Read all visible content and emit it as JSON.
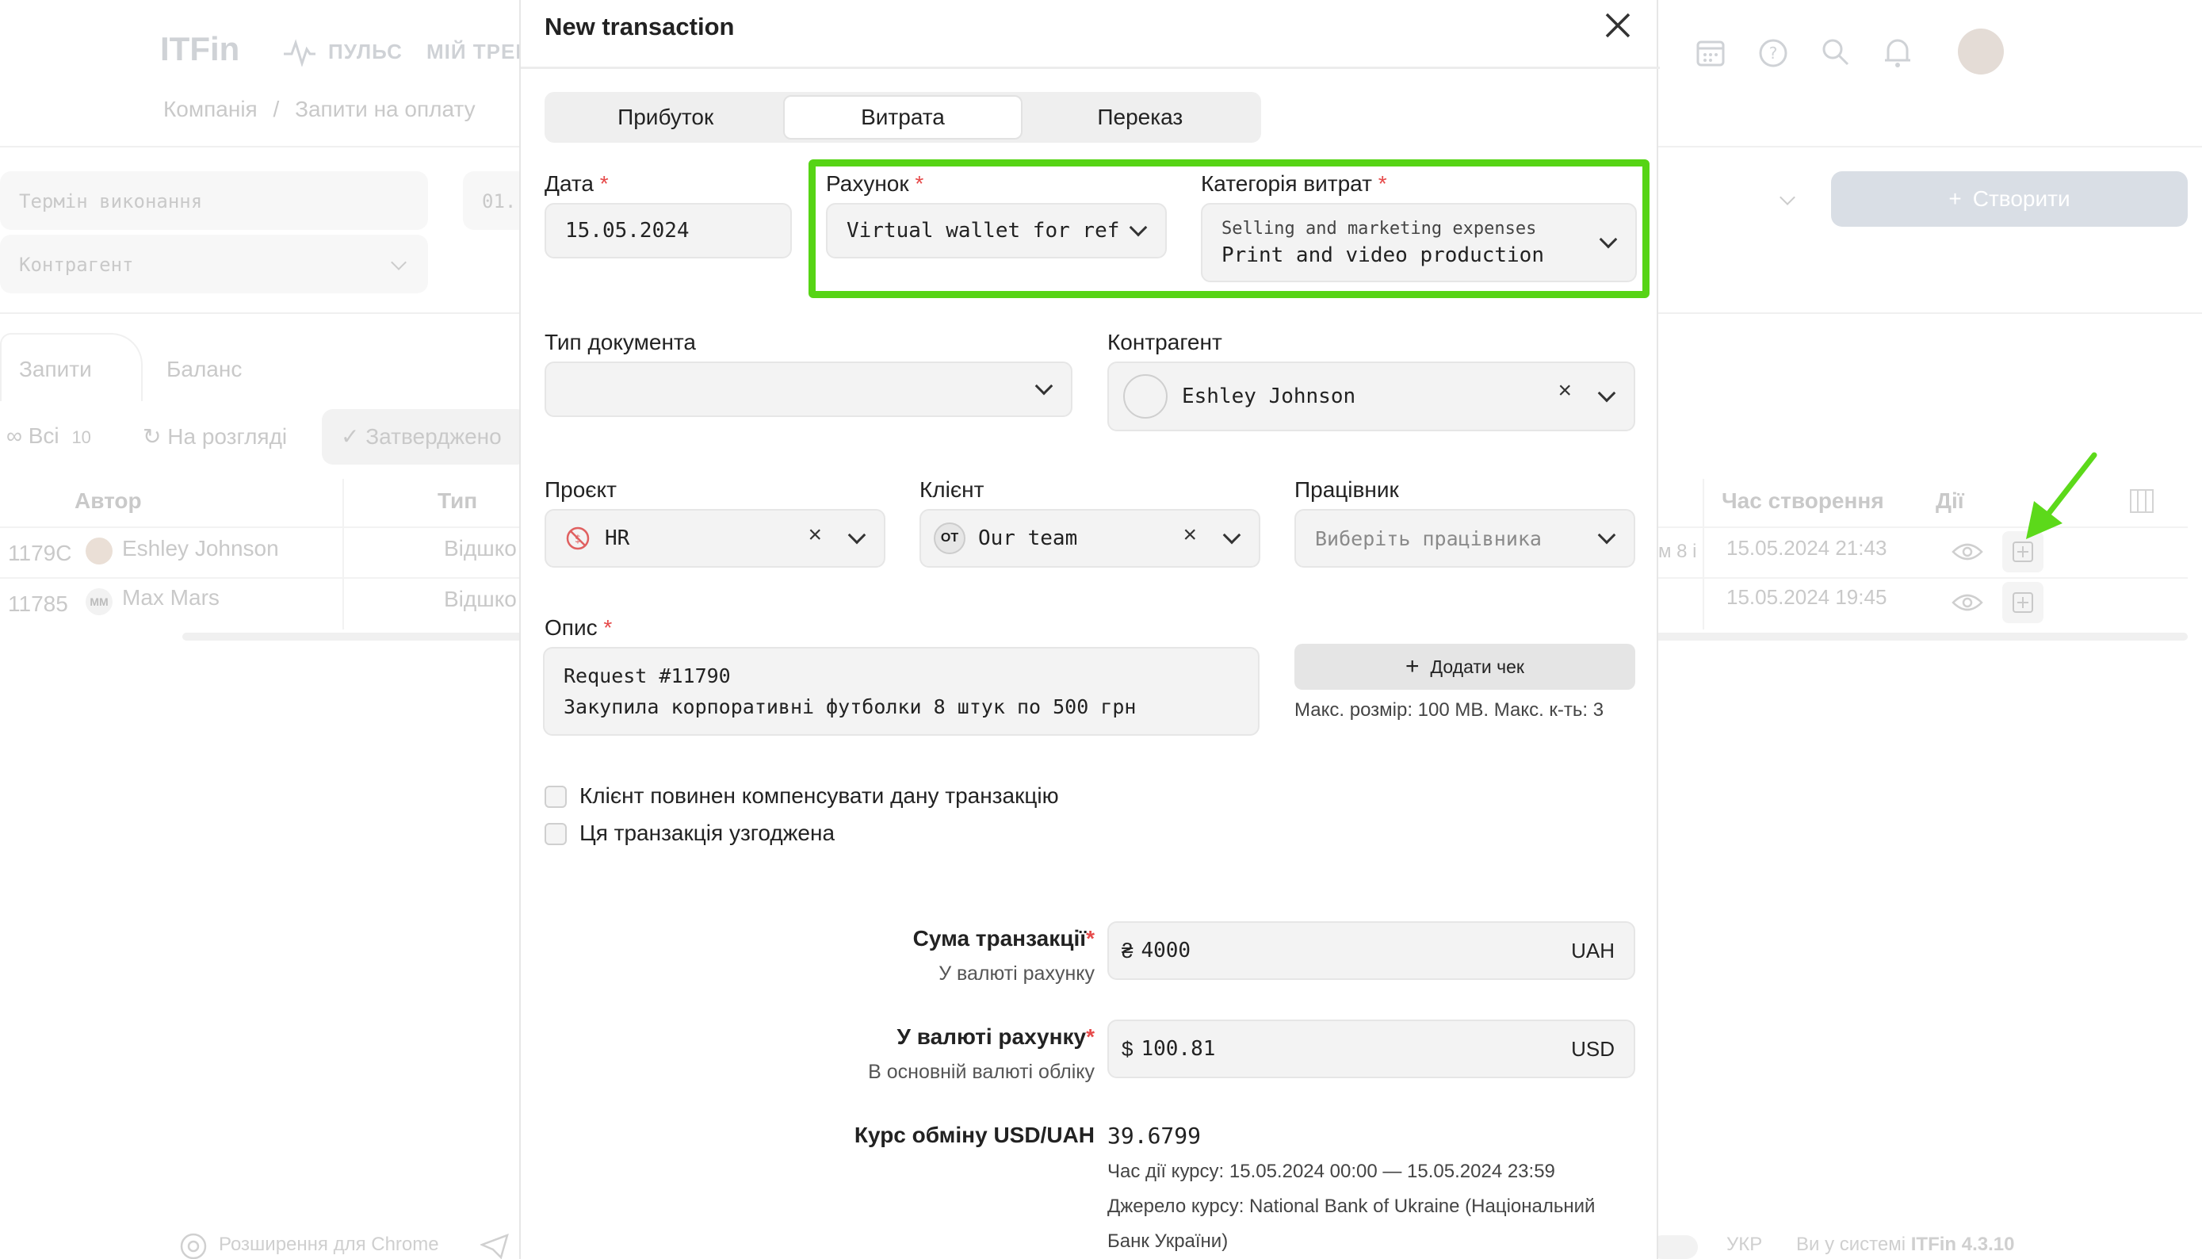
{
  "app": {
    "logo": "ITFin",
    "nav": [
      "ПУЛЬС",
      "МІЙ ТРЕКЕ"
    ],
    "breadcrumb": {
      "root": "Компанія",
      "separator": "/",
      "current": "Запити на оплату"
    },
    "filters": {
      "due_placeholder": "Термін виконання",
      "date_partial": "01.",
      "counterparty_placeholder": "Контрагент"
    },
    "create_button": "Створити",
    "tabs": [
      "Запити",
      "Баланс"
    ],
    "status_filters": [
      {
        "label": "Всі",
        "count": "10"
      },
      {
        "label": "На розгляді"
      },
      {
        "label": "Затверджено"
      }
    ],
    "table": {
      "headers": {
        "author": "Автор",
        "type": "Тип",
        "created": "Час створення",
        "actions": "Дії"
      },
      "rows": [
        {
          "id": "1179С",
          "author": "Eshley Johnson",
          "avatar": "",
          "type": "Відшко",
          "extra": "м 8 і",
          "created": "15.05.2024 21:43"
        },
        {
          "id": "11785",
          "author": "Max Mars",
          "avatar": "MM",
          "type": "Відшко",
          "extra": "",
          "created": "15.05.2024 19:45"
        }
      ]
    },
    "footer": {
      "chrome_ext": "Розширення для Chrome",
      "lang": "УКР",
      "version_prefix": "Ви у системі",
      "version": "ITFin 4.3.10"
    }
  },
  "modal": {
    "title": "New transaction",
    "tabs": [
      {
        "label": "Прибуток",
        "active": false
      },
      {
        "label": "Витрата",
        "active": true
      },
      {
        "label": "Переказ",
        "active": false
      }
    ],
    "date": {
      "label": "Дата",
      "value": "15.05.2024"
    },
    "account": {
      "label": "Рахунок",
      "value": "Virtual wallet for ref"
    },
    "category": {
      "label": "Категорія витрат",
      "group": "Selling and marketing expenses",
      "value": "Print and video production"
    },
    "doc_type": {
      "label": "Тип документа",
      "value": ""
    },
    "counterparty": {
      "label": "Контрагент",
      "value": "Eshley Johnson"
    },
    "project": {
      "label": "Проєкт",
      "value": "HR"
    },
    "client": {
      "label": "Клієнт",
      "badge": "OT",
      "value": "Our team"
    },
    "employee": {
      "label": "Працівник",
      "placeholder": "Виберіть працівника"
    },
    "description": {
      "label": "Опис",
      "line1": "Request #11790",
      "line2": "Закупила корпоративні футболки 8 штук по 500 грн"
    },
    "attach": {
      "button": "Додати чек",
      "hint": "Макс. розмір: 100 MB. Макс. к-ть: 3"
    },
    "checks": [
      {
        "label": "Клієнт повинен компенсувати дану транзакцію",
        "checked": false
      },
      {
        "label": "Ця транзакція узгоджена",
        "checked": false
      }
    ],
    "amount": {
      "label": "Сума транзакції",
      "sub": "У валюті рахунку",
      "symbol": "₴",
      "value": "4000",
      "currency": "UAH"
    },
    "account_amount": {
      "label": "У валюті рахунку",
      "sub": "В основній валюті обліку",
      "symbol": "$",
      "value": "100.81",
      "currency": "USD"
    },
    "rate": {
      "label": "Курс обміну USD/UAH",
      "value": "39.6799",
      "period": "Час дії курсу: 15.05.2024 00:00 — 15.05.2024 23:59",
      "source_line1": "Джерело курсу: National Bank of Ukraine (Національний",
      "source_line2": "Банк України)"
    }
  },
  "colors": {
    "highlight": "#56d415",
    "arrow": "#5cd91a",
    "required": "#e64a4a"
  }
}
